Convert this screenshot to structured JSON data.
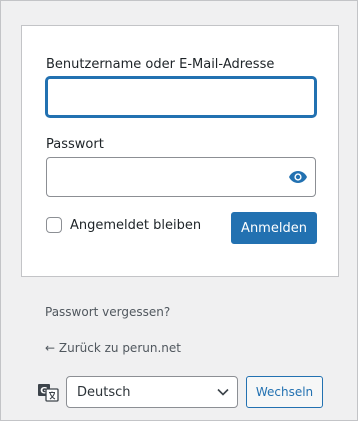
{
  "login_form": {
    "username_label": "Benutzername oder E-Mail-Adresse",
    "username_value": "",
    "password_label": "Passwort",
    "password_value": "",
    "password_toggle_icon": "eye-icon",
    "remember_label": "Angemeldet bleiben",
    "remember_checked": false,
    "submit_label": "Anmelden"
  },
  "links": {
    "lost_password": "Passwort vergessen?",
    "back_to_site": "← Zurück zu perun.net"
  },
  "language": {
    "icon": "translate-icon",
    "selected": "Deutsch",
    "switch_label": "Wechseln"
  },
  "colors": {
    "accent": "#2271b1",
    "background": "#f0f0f1",
    "card": "#ffffff"
  }
}
